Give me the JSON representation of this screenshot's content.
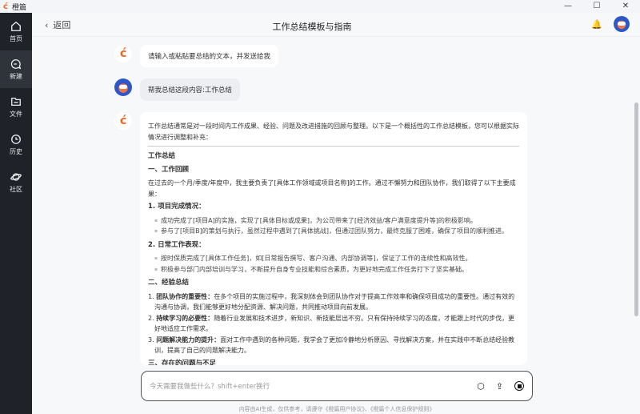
{
  "app": {
    "name": "橙篇",
    "logo": "ć"
  },
  "window": {
    "minimize": "—",
    "maximize": "☐",
    "close": "✕"
  },
  "sidebar": {
    "items": [
      {
        "label": "首页",
        "icon": "home-icon"
      },
      {
        "label": "新建",
        "icon": "new-chat-icon"
      },
      {
        "label": "文件",
        "icon": "folder-icon"
      },
      {
        "label": "历史",
        "icon": "clock-icon"
      },
      {
        "label": "社区",
        "icon": "planet-icon"
      }
    ]
  },
  "header": {
    "back": "返回",
    "title": "工作总结模板与指南"
  },
  "messages": {
    "bot1": "请输入或粘贴要总结的文本，并发送给我",
    "user1": "帮我总结这段内容:工作总结",
    "answer": {
      "intro": "工作总结通常是对一段时间内工作成果、经验、问题及改进措施的回顾与整理。以下是一个概括性的工作总结模板，您可以根据实际情况进行调整和补充：",
      "title": "工作总结",
      "s1": "一、工作回顾",
      "s1p": "在过去的一个月/季度/年度中，我主要负责了[具体工作领域或项目名称]的工作。通过不懈努力和团队协作，我们取得了以下主要成果：",
      "s1i1": "1. 项目完成情况：",
      "s1i1a": "成功完成了[项目A]的实施，实现了[具体目标或成果]，为公司带来了[经济效益/客户满意度提升等]的积极影响。",
      "s1i1b": "参与了[项目B]的策划与执行，虽然过程中遇到了[具体挑战]，但通过团队努力，最终克服了困难，确保了项目的顺利推进。",
      "s1i2": "2. 日常工作表现：",
      "s1i2a": "按时保质完成了[具体工作任务]，如[日常报告撰写、客户沟通、内部协调等]，保证了工作的连续性和高效性。",
      "s1i2b": "积极参与部门内部培训与学习，不断提升自身专业技能和综合素质，为更好地完成工作任务打下了坚实基础。",
      "s2": "二、经验总结",
      "s2i": [
        {
          "n": "1. ",
          "h": "团队协作的重要性：",
          "t": "在多个项目的实施过程中，我深刻体会到团队协作对于提高工作效率和确保项目成功的重要性。通过有效的沟通与协调，我们能够更好地分配资源、解决问题，共同推动项目向前发展。"
        },
        {
          "n": "2. ",
          "h": "持续学习的必要性：",
          "t": "随着行业发展和技术进步，新知识、新技能层出不穷。只有保持持续学习的态度，才能跟上时代的步伐，更好地适应工作需求。"
        },
        {
          "n": "3. ",
          "h": "问题解决能力的提升：",
          "t": "面对工作中遇到的各种问题，我学会了更加冷静地分析原因、寻找解决方案，并在实践中不断总结经验教训，提高了自己的问题解决能力。"
        }
      ],
      "s3": "三、存在的问题与不足"
    }
  },
  "input": {
    "placeholder": "今天需要我做些什么？shift+enter换行"
  },
  "footer": "内容由AI生成，仅供参考，请遵守《橙篇用户协议》、《橙篇个人信息保护规则》"
}
